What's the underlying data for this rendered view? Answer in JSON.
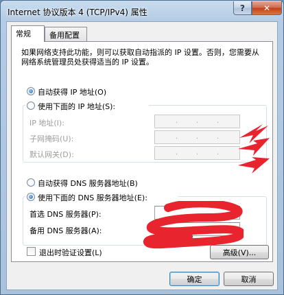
{
  "window": {
    "title": "Internet 协议版本 4 (TCP/IPv4) 属性",
    "help_label": "?",
    "close_label": "✕"
  },
  "tabs": [
    {
      "label": "常规",
      "active": true
    },
    {
      "label": "备用配置",
      "active": false
    }
  ],
  "description": "如果网络支持此功能，则可以获取自动指派的 IP 设置。否则，您需要从网络系统管理员处获得适当的 IP 设置。",
  "ip": {
    "auto_label": "自动获得 IP 地址(O)",
    "auto_checked": true,
    "manual_label": "使用下面的 IP 地址(S):",
    "manual_checked": false,
    "fields": [
      {
        "label": "IP 地址(I):",
        "value": ". . ."
      },
      {
        "label": "子网掩码(U):",
        "value": ". . ."
      },
      {
        "label": "默认网关(D):",
        "value": ". . ."
      }
    ]
  },
  "dns": {
    "auto_label": "自动获得 DNS 服务器地址(B)",
    "auto_checked": false,
    "manual_label": "使用下面的 DNS 服务器地址(E):",
    "manual_checked": true,
    "preferred_label": "首选 DNS 服务器(P):",
    "alternate_label": "备用 DNS 服务器(A):"
  },
  "validate_label": "退出时验证设置(L)",
  "validate_checked": false,
  "advanced_label": "高级(V)...",
  "ok_label": "确定",
  "cancel_label": "取消",
  "colors": {
    "annotation_red": "#e8242e"
  }
}
